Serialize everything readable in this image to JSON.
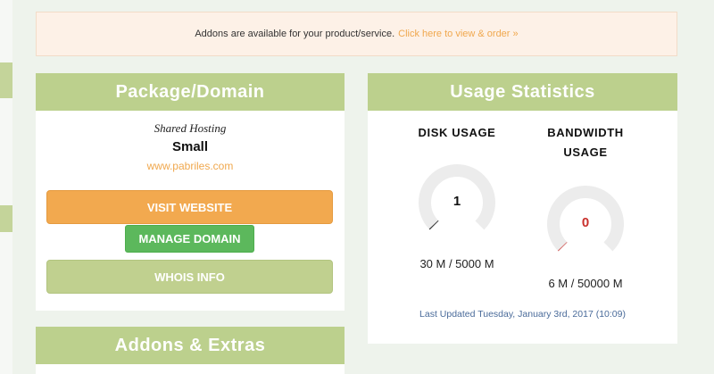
{
  "notice": {
    "text": "Addons are available for your product/service.",
    "link": "Click here to view & order »"
  },
  "package": {
    "title": "Package/Domain",
    "type": "Shared Hosting",
    "name": "Small",
    "domain": "www.pabriles.com",
    "visit_label": "VISIT WEBSITE",
    "manage_label": "MANAGE DOMAIN",
    "whois_label": "WHOIS INFO"
  },
  "usage": {
    "title": "Usage Statistics",
    "disk": {
      "title": "DISK USAGE",
      "value": "1",
      "detail": "30 M / 5000 M",
      "percent": 0.6
    },
    "bandwidth": {
      "title_line1": "BANDWIDTH",
      "title_line2": "USAGE",
      "value": "0",
      "detail": "6 M / 50000 M",
      "percent": 0.012
    },
    "updated": "Last Updated Tuesday, January 3rd, 2017 (10:09)"
  },
  "addons": {
    "title": "Addons & Extras"
  },
  "colors": {
    "panel_header": "#bcd08d",
    "accent_orange": "#f2a94f",
    "success_green": "#5cb85c",
    "bandwidth_value": "#c9302c"
  }
}
